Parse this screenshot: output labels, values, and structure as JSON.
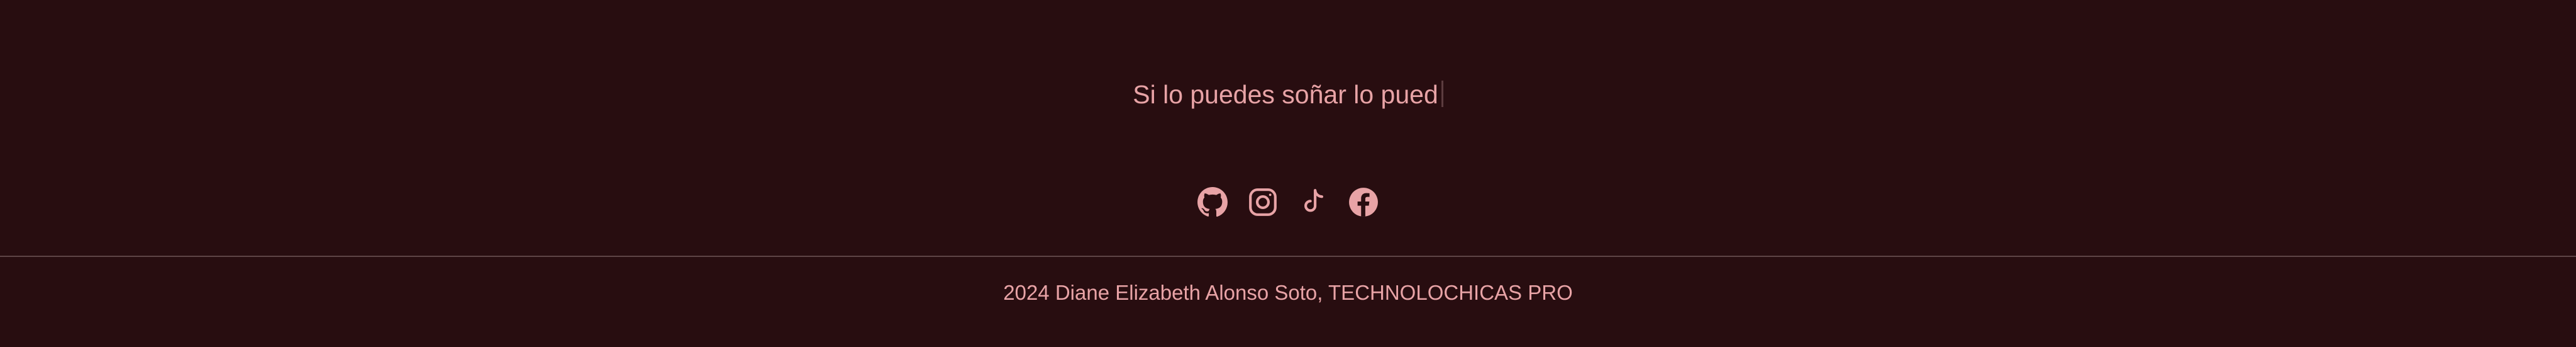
{
  "footer": {
    "tagline": "Si lo puedes soñar lo pued",
    "socials": [
      {
        "name": "GitHub",
        "icon": "github-icon"
      },
      {
        "name": "Instagram",
        "icon": "instagram-icon"
      },
      {
        "name": "TikTok",
        "icon": "tiktok-icon"
      },
      {
        "name": "Facebook",
        "icon": "facebook-icon"
      }
    ],
    "copyright": "2024 Diane Elizabeth Alonso Soto, TECHNOLOCHICAS PRO"
  },
  "colors": {
    "background": "#280d10",
    "text": "#e8a3a6",
    "divider": "#5e4446"
  }
}
